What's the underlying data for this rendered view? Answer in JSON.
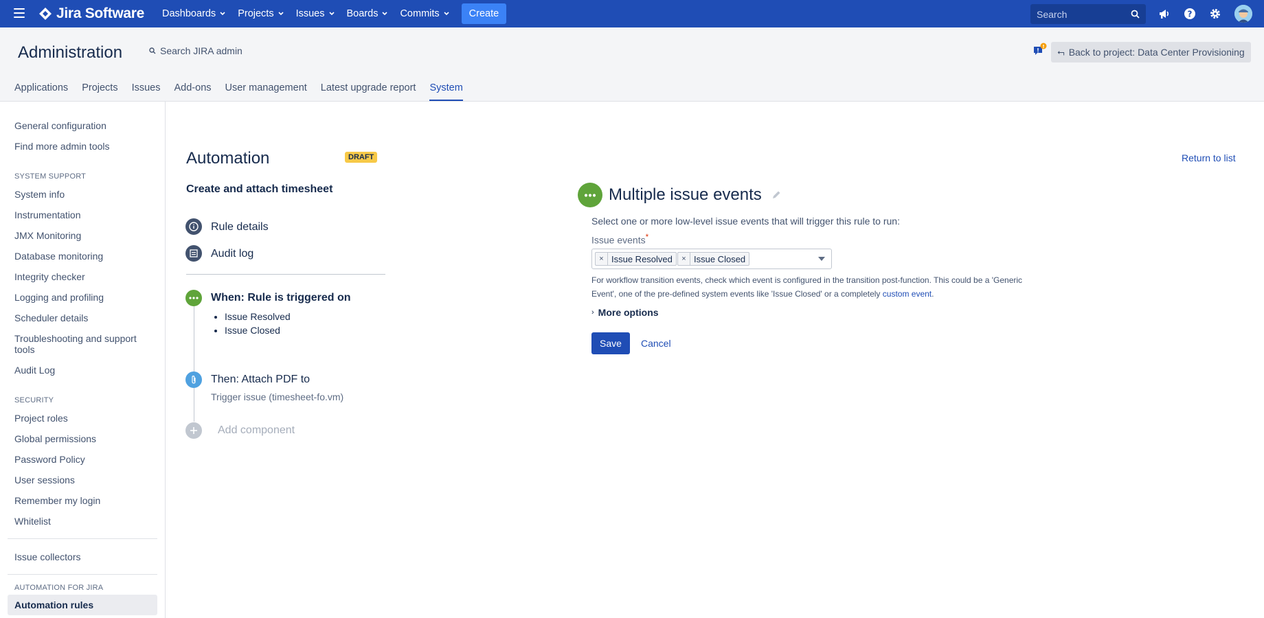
{
  "topnav": {
    "logo_text": "Jira Software",
    "items": [
      "Dashboards",
      "Projects",
      "Issues",
      "Boards",
      "Commits"
    ],
    "create_label": "Create",
    "search_placeholder": "Search",
    "icons": [
      "megaphone-icon",
      "help-icon",
      "settings-icon",
      "avatar"
    ]
  },
  "admin": {
    "title": "Administration",
    "search_label": "Search JIRA admin",
    "notification_count": "!",
    "back_label": "Back to project: Data Center Provisioning",
    "tabs": [
      "Applications",
      "Projects",
      "Issues",
      "Add-ons",
      "User management",
      "Latest upgrade report",
      "System"
    ],
    "active_tab": "System"
  },
  "sidebar": {
    "top_items": [
      "General configuration",
      "Find more admin tools"
    ],
    "system_support_heading": "SYSTEM SUPPORT",
    "system_support_items": [
      "System info",
      "Instrumentation",
      "JMX Monitoring",
      "Database monitoring",
      "Integrity checker",
      "Logging and profiling",
      "Scheduler details",
      "Troubleshooting and support tools",
      "Audit Log"
    ],
    "security_heading": "SECURITY",
    "security_items": [
      "Project roles",
      "Global permissions",
      "Password Policy",
      "User sessions",
      "Remember my login",
      "Whitelist"
    ],
    "issue_collectors": "Issue collectors",
    "automation_heading": "AUTOMATION FOR JIRA",
    "automation_rules": "Automation rules"
  },
  "main": {
    "title": "Automation",
    "badge": "DRAFT",
    "return_link": "Return to list",
    "rule_name": "Create and attach timesheet",
    "rule_details": "Rule details",
    "audit_log": "Audit log",
    "when_label": "When: Rule is triggered on",
    "when_items": [
      "Issue Resolved",
      "Issue Closed"
    ],
    "then_label": "Then: Attach PDF to",
    "then_sub": "Trigger issue (timesheet-fo.vm)",
    "add_component": "Add component"
  },
  "trigger": {
    "title": "Multiple issue events",
    "description": "Select one or more low-level issue events that will trigger this rule to run:",
    "field_label": "Issue events",
    "required_mark": "*",
    "selected": [
      "Issue Resolved",
      "Issue Closed"
    ],
    "help_text": "For workflow transition events, check which event is configured in the transition post-function. This could be a 'Generic Event', one of the pre-defined system events like 'Issue Closed' or a completely ",
    "help_link": "custom event",
    "help_end": ".",
    "more_options": "More options",
    "save": "Save",
    "cancel": "Cancel"
  },
  "colors": {
    "nav": "#1f4db5",
    "create": "#3b82f6",
    "trigger_green": "#5fa43a",
    "action_blue": "#4fa1e0",
    "draft_yellow": "#f7c948"
  }
}
